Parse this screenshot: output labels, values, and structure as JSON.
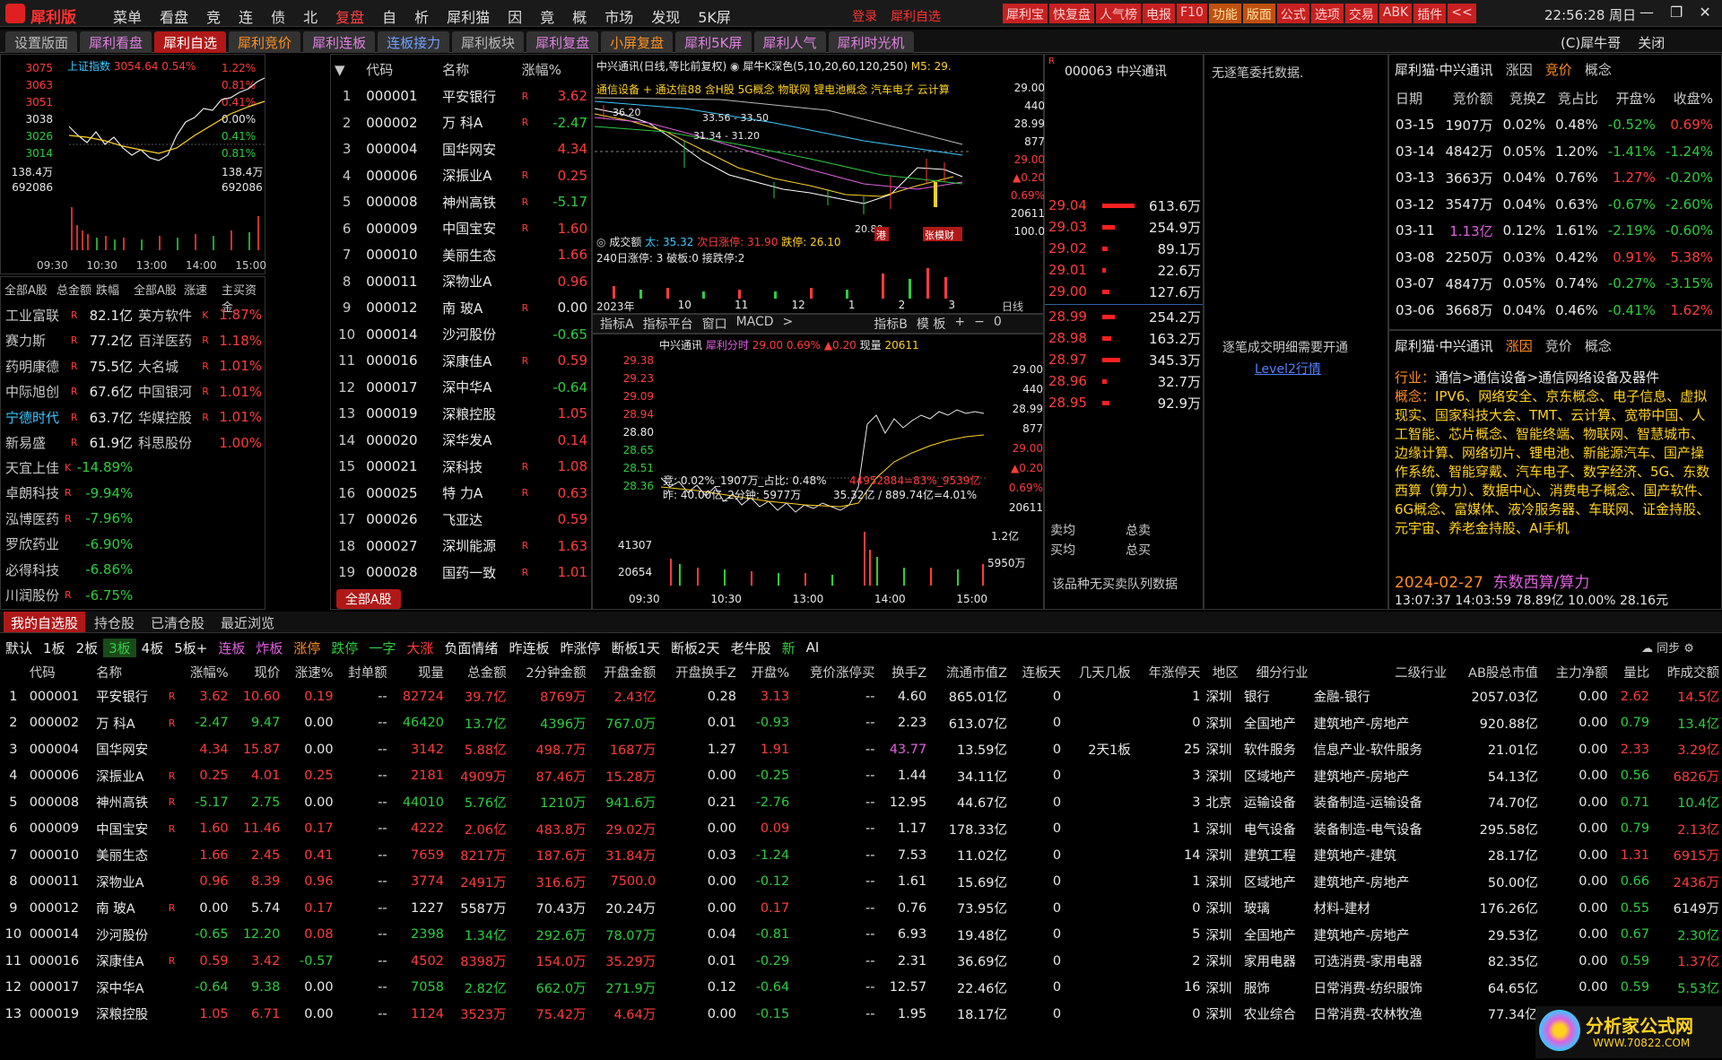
{
  "app": {
    "brand": "犀利版",
    "menus": [
      "菜单",
      "看盘",
      "竞",
      "连",
      "债",
      "北",
      "复盘",
      "自",
      "析",
      "犀利猫",
      "因",
      "竟",
      "概",
      "市场",
      "发现",
      "5K屏"
    ],
    "login": "登录",
    "login2": "犀利自选",
    "toolbtns": [
      "犀利宝",
      "快复盘",
      "人气榜",
      "电报",
      "F10",
      "功能",
      "版面",
      "公式",
      "选项",
      "交易",
      "ABK",
      "插件",
      "<<"
    ],
    "clock": "22:56:28 周日",
    "user": "(C)犀牛哥",
    "close": "关闭"
  },
  "tabs": [
    "设置版面",
    "犀利看盘",
    "犀利自选",
    "犀利竞价",
    "犀利连板",
    "连板接力",
    "犀利板块",
    "犀利复盘",
    "小屏复盘",
    "犀利5K屏",
    "犀利人气",
    "犀利时光机"
  ],
  "index": {
    "name": "上证指数",
    "value": "3054.64",
    "pct": "0.54%",
    "ylabels": [
      "3075",
      "3063",
      "3051",
      "3038",
      "3026",
      "3014",
      "138.4万",
      "692086"
    ],
    "pcts": [
      "1.22%",
      "0.81%",
      "0.41%",
      "0.00%",
      "0.41%",
      "0.81%",
      "138.4万",
      "692086"
    ],
    "times": [
      "09:30",
      "10:30",
      "13:00",
      "14:00",
      "15:00"
    ]
  },
  "rank": {
    "headers": [
      "全部A股",
      "总金额",
      "跌幅",
      "全部A股",
      "涨速",
      "主买资金"
    ],
    "left": [
      [
        "工业富联",
        "R",
        "82.1亿"
      ],
      [
        "赛力斯",
        "R",
        "77.2亿"
      ],
      [
        "药明康德",
        "R",
        "75.5亿"
      ],
      [
        "中际旭创",
        "R",
        "67.6亿"
      ],
      [
        "宁德时代",
        "R",
        "63.7亿"
      ],
      [
        "新易盛",
        "R",
        "61.9亿"
      ]
    ],
    "right": [
      [
        "英方软件",
        "K",
        "1.87%"
      ],
      [
        "百洋医药",
        "R",
        "1.18%"
      ],
      [
        "大名城",
        "R",
        "1.01%"
      ],
      [
        "中国银河",
        "R",
        "1.01%"
      ],
      [
        "华媒控股",
        "R",
        "1.01%"
      ],
      [
        "科思股份",
        "",
        "1.00%"
      ]
    ],
    "losers": [
      [
        "天宜上佳",
        "K",
        "-14.89%"
      ],
      [
        "卓朗科技",
        "R",
        "-9.94%"
      ],
      [
        "泓博医药",
        "R",
        "-7.96%"
      ],
      [
        "罗欣药业",
        "",
        "-6.90%"
      ],
      [
        "必得科技",
        "",
        "-6.86%"
      ],
      [
        "川润股份",
        "R",
        "-6.75%"
      ]
    ]
  },
  "watch": {
    "headers": [
      "代码",
      "名称",
      "涨幅%"
    ],
    "rows": [
      [
        "1",
        "000001",
        "平安银行",
        "R",
        "3.62"
      ],
      [
        "2",
        "000002",
        "万 科A",
        "R",
        "-2.47"
      ],
      [
        "3",
        "000004",
        "国华网安",
        "",
        "4.34"
      ],
      [
        "4",
        "000006",
        "深振业A",
        "R",
        "0.25"
      ],
      [
        "5",
        "000008",
        "神州高铁",
        "R",
        "-5.17"
      ],
      [
        "6",
        "000009",
        "中国宝安",
        "R",
        "1.60"
      ],
      [
        "7",
        "000010",
        "美丽生态",
        "",
        "1.66"
      ],
      [
        "8",
        "000011",
        "深物业A",
        "",
        "0.96"
      ],
      [
        "9",
        "000012",
        "南 玻A",
        "R",
        "0.00"
      ],
      [
        "10",
        "000014",
        "沙河股份",
        "",
        "-0.65"
      ],
      [
        "11",
        "000016",
        "深康佳A",
        "R",
        "0.59"
      ],
      [
        "12",
        "000017",
        "深中华A",
        "",
        "-0.64"
      ],
      [
        "13",
        "000019",
        "深粮控股",
        "",
        "1.05"
      ],
      [
        "14",
        "000020",
        "深华发A",
        "",
        "0.14"
      ],
      [
        "15",
        "000021",
        "深科技",
        "R",
        "1.08"
      ],
      [
        "16",
        "000025",
        "特 力A",
        "R",
        "0.63"
      ],
      [
        "17",
        "000026",
        "飞亚达",
        "",
        "0.59"
      ],
      [
        "18",
        "000027",
        "深圳能源",
        "R",
        "1.63"
      ],
      [
        "19",
        "000028",
        "国药一致",
        "R",
        "1.01"
      ]
    ],
    "footer": "全部A股"
  },
  "kline": {
    "title": "中兴通讯(日线,等比前复权)",
    "title2": "犀牛K深色(5,10,20,60,120,250)",
    "m5": "M5: 29.",
    "concepts": "通信设备 + 通达信88 含H股 5G概念 物联网 锂电池概念 汽车电子 云计算",
    "p1": "36.20",
    "p2": "33.56 - 33.50",
    "p3": "31.34 - 31.20",
    "low": "20.80",
    "tag1": "港",
    "tag2": "张模财",
    "right": [
      "29.00",
      "440",
      "28.99",
      "877",
      "29.00",
      "▲0.20",
      "0.69%",
      "20611",
      "100.0"
    ],
    "vol": "成交额",
    "vol1": "太: 35.32",
    "vol2": "次日涨停: 31.90",
    "vol3": "跌停: 26.10",
    "stat": "240日涨停: 3  破板:0  接跌停:2",
    "xlabels": [
      "2023年",
      "10",
      "11",
      "12",
      "1",
      "2",
      "3"
    ],
    "period": "日线",
    "subtabs": [
      "指标A",
      "指标平台",
      "窗口",
      "MACD",
      ">",
      "指标B",
      "模 板",
      "+",
      "−",
      "0"
    ]
  },
  "intraday": {
    "name": "中兴通讯",
    "mode": "犀利分时",
    "price": "29.00",
    "pct": "0.69%",
    "chg": "▲0.20",
    "vol": "现量",
    "volval": "20611",
    "ylabels": [
      "29.38",
      "29.23",
      "29.09",
      "28.94",
      "28.80",
      "28.65",
      "28.51",
      "28.36"
    ],
    "rlabels": [
      "29.00",
      "440",
      "28.99",
      "877",
      "29.00",
      "▲0.20",
      "0.69%",
      "20611"
    ],
    "info1": "竞: 0.02%_1907万_占比: 0.48%",
    "info2": "昨: 40.00亿_2分钟: 5977万",
    "info3": "35.32亿 / 889.74亿=4.01%",
    "info4": "44952884=83%_9539亿",
    "vlabels": [
      "41307",
      "20654"
    ],
    "r2": [
      "1.2亿",
      "5950万"
    ],
    "times": [
      "09:30",
      "10:30",
      "13:00",
      "14:00",
      "15:00"
    ]
  },
  "order": {
    "code": "000063",
    "name": "中兴通讯",
    "asks": [
      [
        "29.04",
        "613.6万"
      ],
      [
        "29.03",
        "254.9万"
      ],
      [
        "29.02",
        "89.1万"
      ],
      [
        "29.01",
        "22.6万"
      ],
      [
        "29.00",
        "127.6万"
      ]
    ],
    "bids": [
      [
        "28.99",
        "254.2万"
      ],
      [
        "28.98",
        "163.2万"
      ],
      [
        "28.97",
        "345.3万"
      ],
      [
        "28.96",
        "32.7万"
      ],
      [
        "28.95",
        "92.9万"
      ]
    ],
    "sell": "卖均",
    "sellt": "总卖",
    "buy": "买均",
    "buyt": "总买",
    "noqueue": "该品种无买卖队列数据"
  },
  "entrust": {
    "none": "无逐笔委托数据.",
    "need": "逐笔成交明细需要开通",
    "lvl2": "Level2行情"
  },
  "hist": {
    "tab": "犀利猫·中兴通讯",
    "tabs2": [
      "涨因",
      "竞价",
      "概念"
    ],
    "headers": [
      "日期",
      "竞价额",
      "竞换Z",
      "竞占比",
      "开盘%",
      "收盘%"
    ],
    "rows": [
      [
        "03-15",
        "1907万",
        "0.02%",
        "0.48%",
        "-0.52%",
        "0.69%"
      ],
      [
        "03-14",
        "4842万",
        "0.05%",
        "1.20%",
        "-1.41%",
        "-1.24%"
      ],
      [
        "03-13",
        "3663万",
        "0.04%",
        "0.76%",
        "1.27%",
        "-0.20%"
      ],
      [
        "03-12",
        "3547万",
        "0.04%",
        "0.63%",
        "-0.67%",
        "-2.60%"
      ],
      [
        "03-11",
        "1.13亿",
        "0.12%",
        "1.61%",
        "-2.19%",
        "-0.60%"
      ],
      [
        "03-08",
        "2250万",
        "0.03%",
        "0.42%",
        "0.91%",
        "5.38%"
      ],
      [
        "03-07",
        "4847万",
        "0.05%",
        "0.74%",
        "-0.27%",
        "-3.15%"
      ],
      [
        "03-06",
        "3668万",
        "0.04%",
        "0.46%",
        "-0.41%",
        "1.62%"
      ]
    ]
  },
  "concept": {
    "tab": "犀利猫·中兴通讯",
    "tabs2": [
      "涨因",
      "竞价",
      "概念"
    ],
    "industry_label": "行业：",
    "industry": "通信>通信设备>通信网络设备及器件",
    "concept_label": "概念：",
    "concepts": "IPV6、网络安全、京东概念、电子信息、虚拟现实、国家科技大会、TMT、云计算、宽带中国、人工智能、芯片概念、智能终端、物联网、智慧城市、边缘计算、网络切片、锂电池、新能源汽车、国产操作系统、智能穿戴、汽车电子、数字经济、5G、东数西算（算力）、数据中心、消费电子概念、国产软件、6G概念、富媒体、液冷服务器、车联网、证金持股、元宇宙、养老金持股、AI手机",
    "date": "2024-02-27",
    "event": "东数西算/算力",
    "stats": "13:07:37 14:03:59  78.89亿  10.00%  28.16元"
  },
  "bottomtabs": [
    "我的自选股",
    "持仓股",
    "已清仓股",
    "最近浏览"
  ],
  "filters": [
    "默认",
    "1板",
    "2板",
    "3板",
    "4板",
    "5板+",
    "连板",
    "炸板",
    "涨停",
    "跌停",
    "一字",
    "大涨",
    "负面情绪",
    "昨连板",
    "昨涨停",
    "断板1天",
    "断板2天",
    "老牛股",
    "新",
    "AI"
  ],
  "sync": "同步",
  "table": {
    "headers": [
      "",
      "代码",
      "名称",
      "",
      "涨幅%",
      "现价",
      "涨速%",
      "封单额",
      "现量",
      "总金额",
      "2分钟金额",
      "开盘金额",
      "开盘换手Z",
      "开盘%",
      "竞价涨停买",
      "换手Z",
      "流通市值Z",
      "连板天",
      "几天几板",
      "年涨停天",
      "地区",
      "细分行业",
      "二级行业",
      "AB股总市值",
      "主力净额",
      "量比",
      "昨成交额"
    ],
    "rows": [
      [
        "1",
        "000001",
        "平安银行",
        "R",
        "3.62",
        "10.60",
        "0.19",
        "--",
        "82724",
        "39.7亿",
        "8769万",
        "2.43亿",
        "0.28",
        "3.13",
        "--",
        "4.60",
        "865.01亿",
        "0",
        "",
        "1",
        "深圳",
        "银行",
        "金融-银行",
        "2057.03亿",
        "0.00",
        "2.62",
        "14.5亿"
      ],
      [
        "2",
        "000002",
        "万 科A",
        "R",
        "-2.47",
        "9.47",
        "0.00",
        "--",
        "46420",
        "13.7亿",
        "4396万",
        "767.0万",
        "0.01",
        "-0.93",
        "--",
        "2.23",
        "613.07亿",
        "0",
        "",
        "0",
        "深圳",
        "全国地产",
        "建筑地产-房地产",
        "920.88亿",
        "0.00",
        "0.79",
        "13.4亿"
      ],
      [
        "3",
        "000004",
        "国华网安",
        "",
        "4.34",
        "15.87",
        "0.00",
        "--",
        "3142",
        "5.88亿",
        "498.7万",
        "1687万",
        "1.27",
        "1.91",
        "--",
        "43.77",
        "13.59亿",
        "0",
        "2天1板",
        "25",
        "深圳",
        "软件服务",
        "信息产业-软件服务",
        "21.01亿",
        "0.00",
        "2.33",
        "3.29亿"
      ],
      [
        "4",
        "000006",
        "深振业A",
        "R",
        "0.25",
        "4.01",
        "0.25",
        "--",
        "2181",
        "4909万",
        "87.46万",
        "15.28万",
        "0.00",
        "-0.25",
        "--",
        "1.44",
        "34.11亿",
        "0",
        "",
        "3",
        "深圳",
        "区域地产",
        "建筑地产-房地产",
        "54.13亿",
        "0.00",
        "0.56",
        "6826万"
      ],
      [
        "5",
        "000008",
        "神州高铁",
        "R",
        "-5.17",
        "2.75",
        "0.00",
        "--",
        "44010",
        "5.76亿",
        "1210万",
        "941.6万",
        "0.21",
        "-2.76",
        "--",
        "12.95",
        "44.67亿",
        "0",
        "",
        "3",
        "北京",
        "运输设备",
        "装备制造-运输设备",
        "74.70亿",
        "0.00",
        "0.71",
        "10.4亿"
      ],
      [
        "6",
        "000009",
        "中国宝安",
        "R",
        "1.60",
        "11.46",
        "0.17",
        "--",
        "4222",
        "2.06亿",
        "483.8万",
        "29.02万",
        "0.00",
        "0.09",
        "--",
        "1.17",
        "178.33亿",
        "0",
        "",
        "1",
        "深圳",
        "电气设备",
        "装备制造-电气设备",
        "295.58亿",
        "0.00",
        "0.79",
        "2.13亿"
      ],
      [
        "7",
        "000010",
        "美丽生态",
        "",
        "1.66",
        "2.45",
        "0.41",
        "--",
        "7659",
        "8217万",
        "187.6万",
        "31.84万",
        "0.03",
        "-1.24",
        "--",
        "7.53",
        "11.02亿",
        "0",
        "",
        "14",
        "深圳",
        "建筑工程",
        "建筑地产-建筑",
        "28.17亿",
        "0.00",
        "1.31",
        "6915万"
      ],
      [
        "8",
        "000011",
        "深物业A",
        "",
        "0.96",
        "8.39",
        "0.96",
        "--",
        "3774",
        "2491万",
        "316.6万",
        "7500.0",
        "0.00",
        "-0.12",
        "--",
        "1.61",
        "15.69亿",
        "0",
        "",
        "1",
        "深圳",
        "区域地产",
        "建筑地产-房地产",
        "50.00亿",
        "0.00",
        "0.66",
        "2436万"
      ],
      [
        "9",
        "000012",
        "南 玻A",
        "R",
        "0.00",
        "5.74",
        "0.17",
        "--",
        "1227",
        "5587万",
        "70.43万",
        "20.24万",
        "0.00",
        "0.17",
        "--",
        "0.76",
        "73.95亿",
        "0",
        "",
        "0",
        "深圳",
        "玻璃",
        "材料-建材",
        "176.26亿",
        "0.00",
        "0.55",
        "6149万"
      ],
      [
        "10",
        "000014",
        "沙河股份",
        "",
        "-0.65",
        "12.20",
        "0.08",
        "--",
        "2398",
        "1.34亿",
        "292.6万",
        "78.07万",
        "0.04",
        "-0.81",
        "--",
        "6.93",
        "19.48亿",
        "0",
        "",
        "5",
        "深圳",
        "全国地产",
        "建筑地产-房地产",
        "29.53亿",
        "0.00",
        "0.67",
        "2.30亿"
      ],
      [
        "11",
        "000016",
        "深康佳A",
        "R",
        "0.59",
        "3.42",
        "-0.57",
        "--",
        "4502",
        "8398万",
        "154.0万",
        "35.29万",
        "0.01",
        "-0.29",
        "--",
        "2.31",
        "36.69亿",
        "0",
        "",
        "2",
        "深圳",
        "家用电器",
        "可选消费-家用电器",
        "82.35亿",
        "0.00",
        "0.59",
        "1.37亿"
      ],
      [
        "12",
        "000017",
        "深中华A",
        "",
        "-0.64",
        "9.38",
        "0.00",
        "--",
        "7058",
        "2.82亿",
        "662.0万",
        "271.9万",
        "0.12",
        "-0.64",
        "--",
        "12.57",
        "22.46亿",
        "0",
        "",
        "16",
        "深圳",
        "服饰",
        "日常消费-纺织服饰",
        "64.65亿",
        "0.00",
        "0.59",
        "5.53亿"
      ],
      [
        "13",
        "000019",
        "深粮控股",
        "",
        "1.05",
        "6.71",
        "0.00",
        "--",
        "1124",
        "3523万",
        "75.42万",
        "4.64万",
        "0.00",
        "-0.15",
        "--",
        "1.95",
        "18.17亿",
        "0",
        "",
        "0",
        "深圳",
        "农业综合",
        "日常消费-农林牧渔",
        "77.34亿",
        "",
        "",
        ""
      ]
    ]
  },
  "watermark": {
    "text": "分析家公式网",
    "url": "WWW.70822.COM"
  },
  "colors": {
    "up": "#ff3c3c",
    "down": "#2ecc40",
    "accent": "#b01818",
    "bg": "#000000"
  }
}
